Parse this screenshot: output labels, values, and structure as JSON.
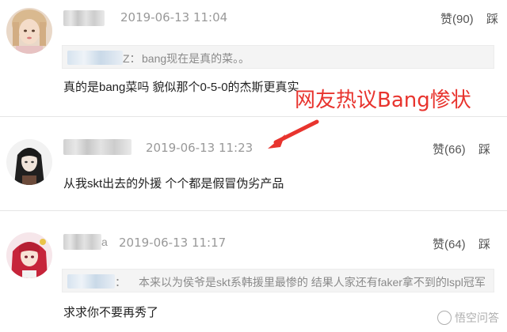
{
  "comments": [
    {
      "timestamp": "2019-06-13 11:04",
      "likes": "赞(90)",
      "dislike": "踩",
      "reply": {
        "author_suffix": "Z：",
        "text": "bang现在是真的菜。。"
      },
      "text": "真的是bang菜吗 貌似那个0-5-0的杰斯更真实",
      "avatar_icon": "girl-portrait-avatar"
    },
    {
      "timestamp": "2019-06-13 11:23",
      "likes": "赞(66)",
      "dislike": "踩",
      "text": "从我skt出去的外援 个个都是假冒伪劣产品",
      "avatar_icon": "dark-hair-anime-avatar"
    },
    {
      "username_suffix": "a",
      "timestamp": "2019-06-13 11:17",
      "likes": "赞(64)",
      "dislike": "踩",
      "reply": {
        "author_suffix": "：",
        "text": "本来以为侯爷是skt系韩援里最惨的 结果人家还有faker拿不到的lspl冠军"
      },
      "text": "求求你不要再秀了",
      "avatar_icon": "red-hair-anime-avatar"
    }
  ],
  "annotation": {
    "text": "网友热议Bang惨状",
    "color": "#e8342e"
  },
  "watermark": {
    "text": "悟空问答",
    "icon": "wukong-logo-icon"
  }
}
